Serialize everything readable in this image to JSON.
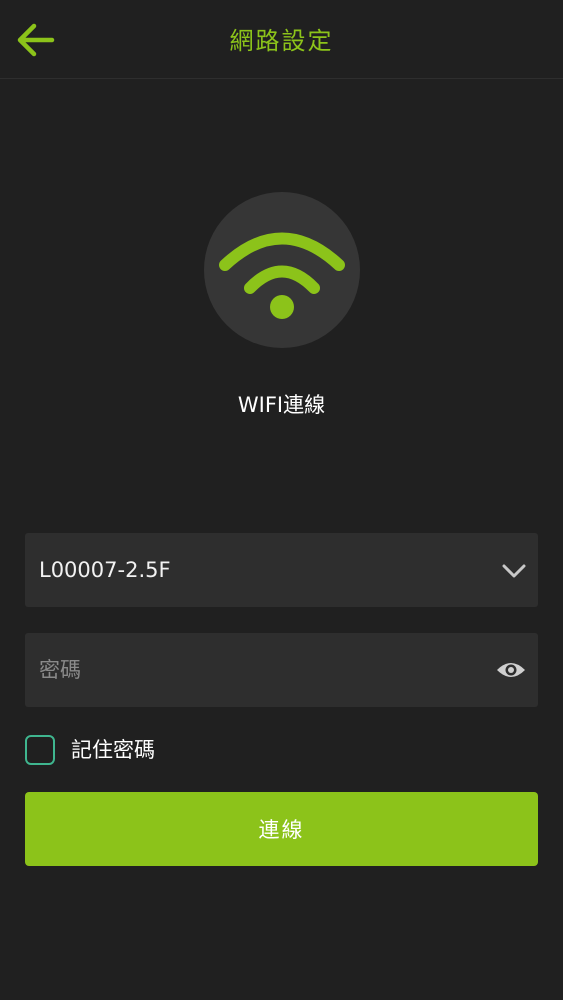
{
  "header": {
    "title": "網路設定",
    "back_icon": "arrow-left-icon"
  },
  "hero": {
    "icon": "wifi-icon",
    "caption": "WIFI連線"
  },
  "form": {
    "ssid": {
      "value": "L00007-2.5F",
      "icon": "chevron-down-icon"
    },
    "password": {
      "value": "",
      "placeholder": "密碼",
      "icon": "eye-icon"
    },
    "remember": {
      "label": "記住密碼",
      "checked": false
    },
    "connect_label": "連線"
  },
  "colors": {
    "accent": "#8cc31a",
    "background": "#202020",
    "field": "#2e2e2e",
    "circle": "#363636",
    "checkbox_border": "#3fb68f"
  }
}
